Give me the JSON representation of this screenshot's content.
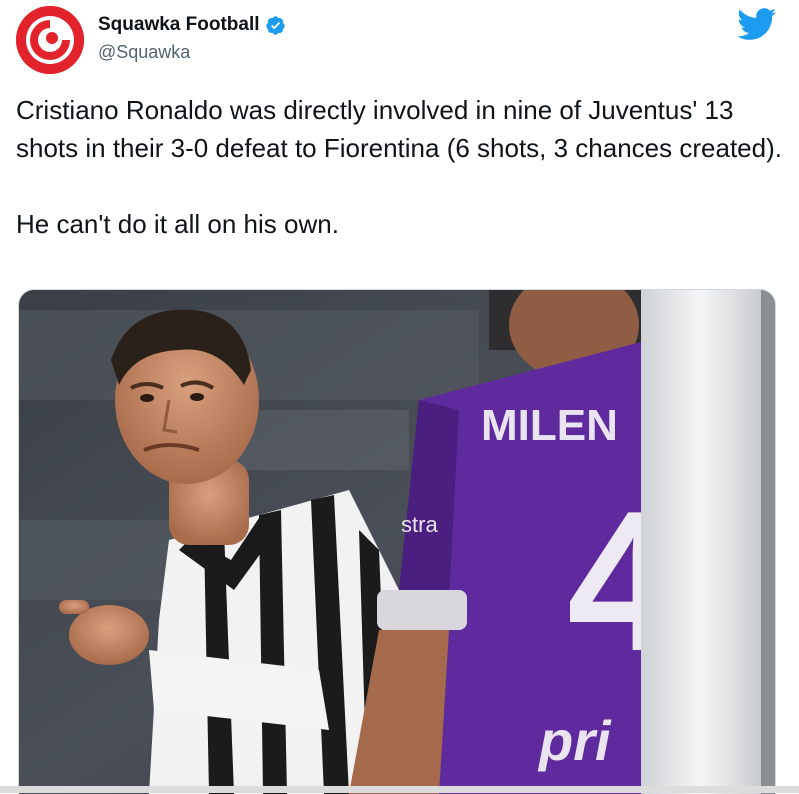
{
  "tweet": {
    "display_name": "Squawka Football",
    "handle": "@Squawka",
    "text_paragraphs": [
      "Cristiano Ronaldo was directly involved in nine of Juventus' 13 shots in their 3-0 defeat to Fiorentina (6 shots, 3 chances created).",
      "He can't do it all on his own."
    ],
    "verified": true
  },
  "media": {
    "shirt_name": "MILEN",
    "shirt_number": "4",
    "sponsor_text": "pri",
    "sleeve_text": "stra"
  },
  "icons": {
    "avatar": "squawka-logo-icon",
    "verified": "verified-badge-icon",
    "platform": "twitter-bird-icon"
  },
  "colors": {
    "brand_red": "#e3232c",
    "verified_blue": "#1d9bf0",
    "twitter_blue": "#1d9bf0",
    "fiorentina_purple": "#5f2a9e"
  }
}
